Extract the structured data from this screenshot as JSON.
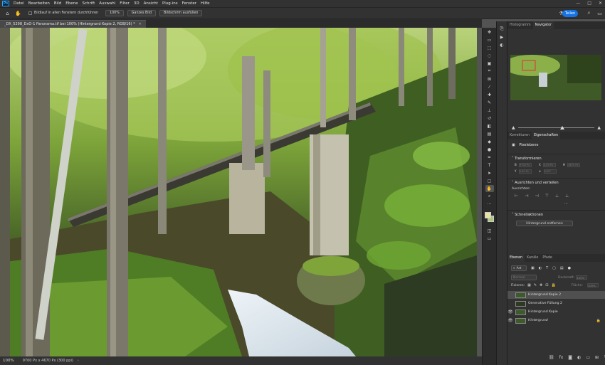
{
  "app": {
    "logo": "Ps",
    "brand_color": "#31a8ff"
  },
  "menu": [
    "Datei",
    "Bearbeiten",
    "Bild",
    "Ebene",
    "Schrift",
    "Auswahl",
    "Filter",
    "3D",
    "Ansicht",
    "Plug-ins",
    "Fenster",
    "Hilfe"
  ],
  "window_controls": {
    "minimize": "—",
    "maximize": "□",
    "close": "✕"
  },
  "options_bar": {
    "scroll_all_label": "Bildlauf in allen Fenstern durchführen",
    "zoom_100": "100%",
    "fit_screen": "Ganzes Bild",
    "fill_screen": "Bildschirm ausfüllen",
    "share_label": "Teilen"
  },
  "document": {
    "tab_title": "_DX_5298_DxO-1 Panorama.tif bei 100% (Hintergrund Kopie 2, RGB/16) *",
    "zoom": "100%",
    "dimensions": "9700 Px x 4670 Px (300 ppi)"
  },
  "panels": {
    "top_tabs": [
      "Histogramm",
      "Navigator"
    ],
    "top_active": "Navigator",
    "mid_tabs": [
      "Korrekturen",
      "Eigenschaften"
    ],
    "mid_active": "Eigenschaften",
    "properties": {
      "pixel_layer_label": "Pixelebene",
      "transform_title": "Transformieren",
      "transform_values": [
        "0,00 Px",
        "0,00 Px",
        "9700 Px",
        "4670 Px",
        "0,00°"
      ],
      "align_title": "Ausrichten und verteilen",
      "align_sub": "Ausrichten:",
      "quick_actions_title": "Schnellaktionen",
      "remove_bg_button": "Hintergrund entfernen"
    },
    "layer_tabs": [
      "Ebenen",
      "Kanäle",
      "Pfade"
    ],
    "layer_active": "Ebenen",
    "filter_kind": "Art",
    "blend_mode": "Normal",
    "opacity_label": "Deckkraft:",
    "opacity_value": "100%",
    "lock_label": "Fixieren:",
    "fill_label": "Fläche:",
    "fill_value": "100%",
    "layers": [
      {
        "name": "Hintergrund Kopie 2",
        "visible": false,
        "selected": true
      },
      {
        "name": "Generative Füllung 2",
        "visible": false,
        "selected": false
      },
      {
        "name": "Hintergrund Kopie",
        "visible": true,
        "selected": false
      },
      {
        "name": "Hintergrund",
        "visible": true,
        "selected": false,
        "locked": true
      }
    ]
  },
  "colors": {
    "foreground": "#e8e3a0",
    "background": "#a8c878"
  }
}
